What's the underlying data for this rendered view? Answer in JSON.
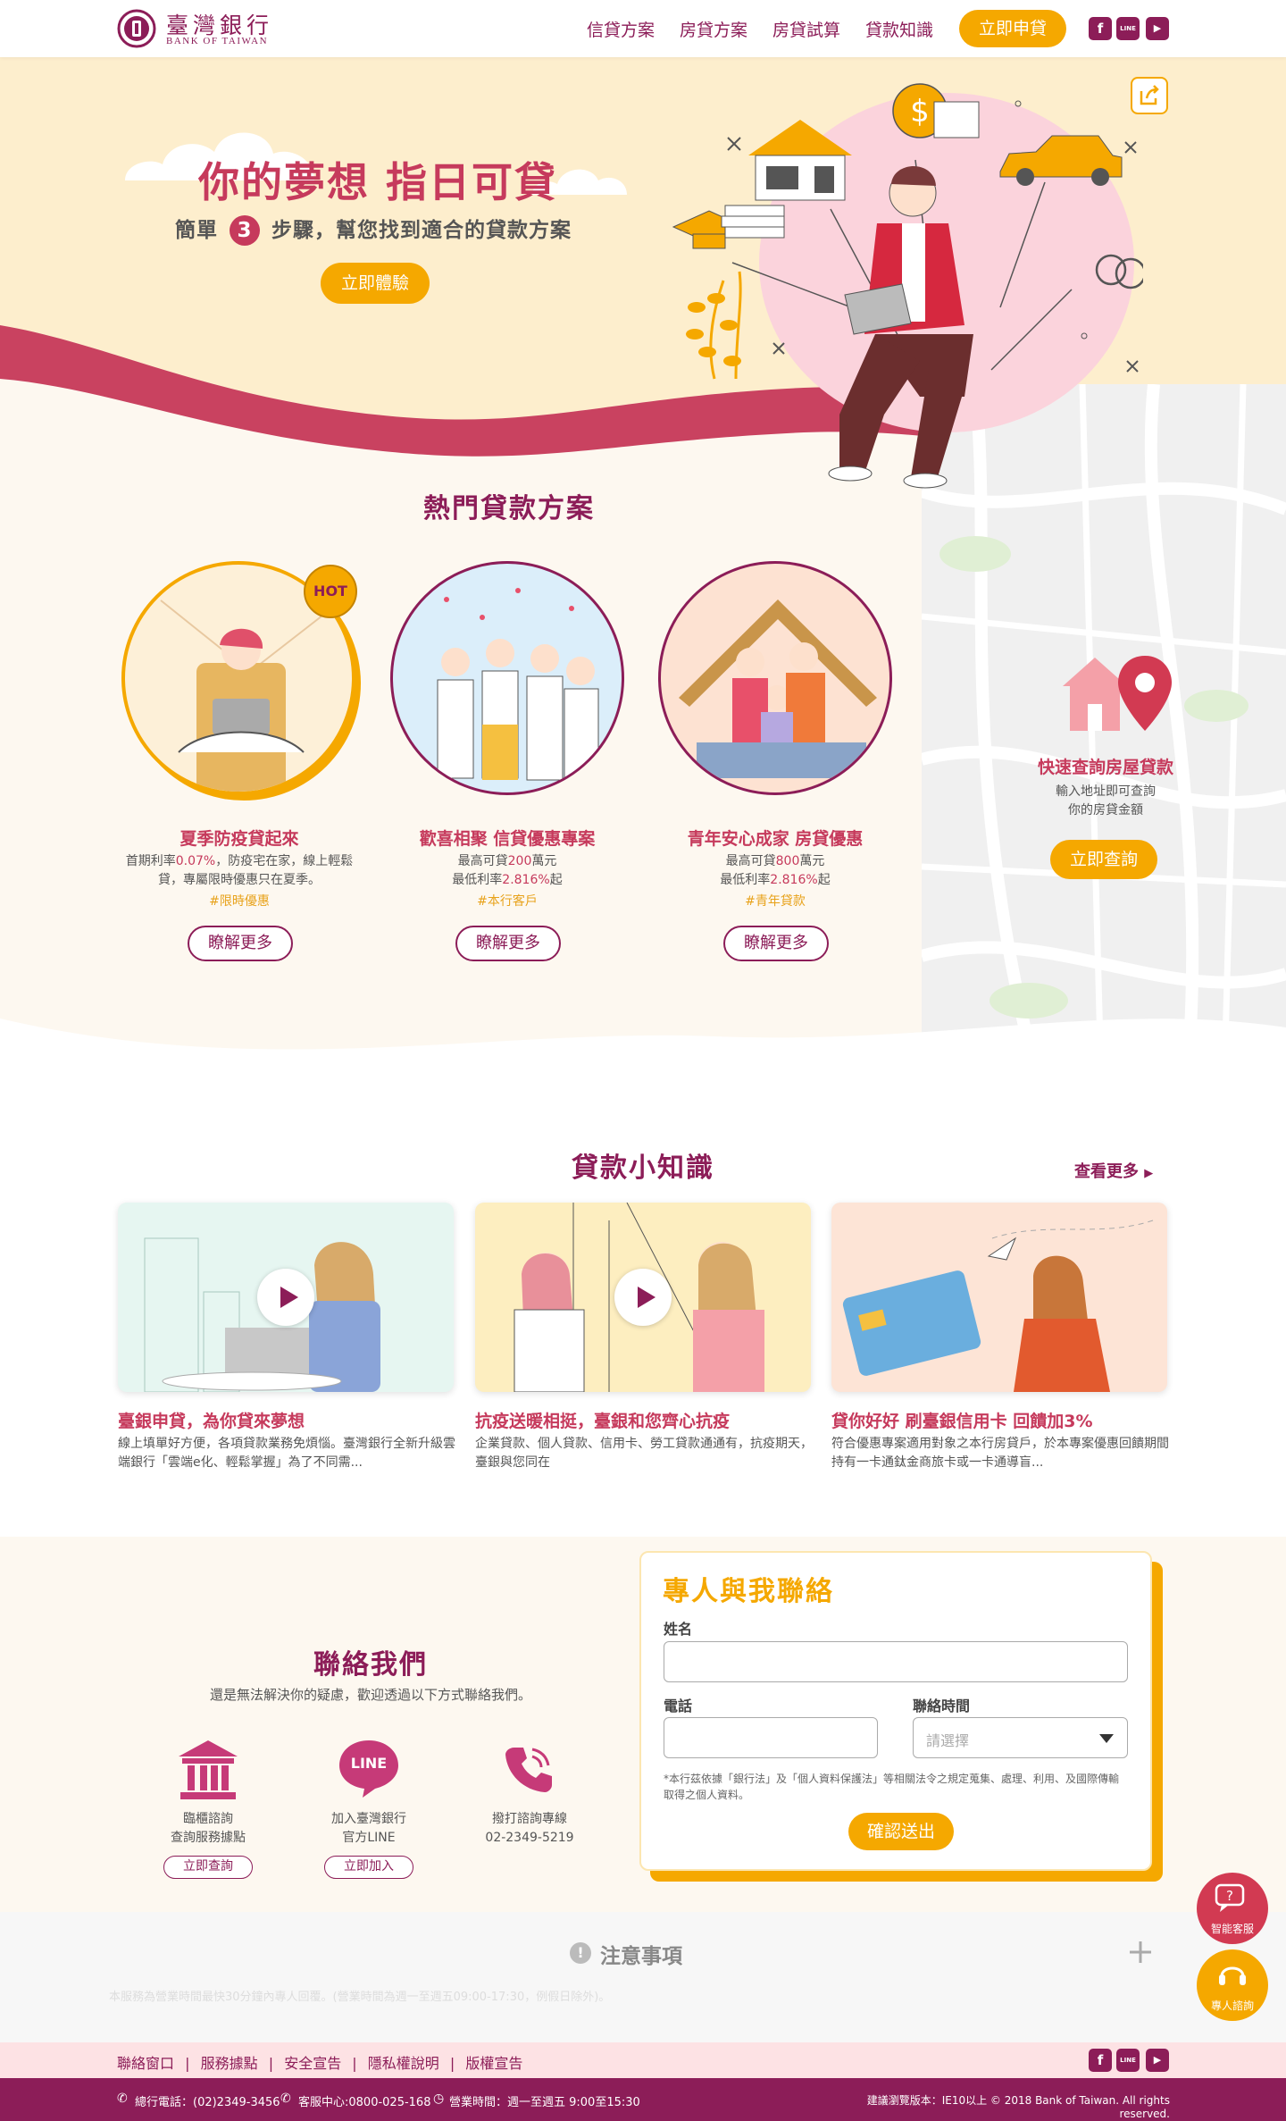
{
  "header": {
    "logo_cn": "臺灣銀行",
    "logo_en": "BANK OF TAIWAN",
    "nav": [
      "信貸方案",
      "房貸方案",
      "房貸試算",
      "貸款知識"
    ],
    "apply_label": "立即申貸",
    "social": [
      "f",
      "LINE",
      "▶"
    ]
  },
  "hero": {
    "title": "你的夢想 指日可貸",
    "sub_pre": "簡單",
    "sub_num": "3",
    "sub_post": "步驟，幫您找到適合的貸款方案",
    "cta": "立即體驗"
  },
  "popular": {
    "title": "熱門貸款方案",
    "cards": [
      {
        "badge": "HOT",
        "title": "夏季防疫貸起來",
        "line1_pre": "首期利率",
        "line1_hl": "0.07%",
        "line1_post": "，防疫宅在家，線上輕鬆",
        "line2": "貸，專屬限時優惠只在夏季。",
        "tag": "#限時優惠",
        "more": "瞭解更多"
      },
      {
        "title": "歡喜相聚 信貸優惠專案",
        "line1_pre": "最高可貸",
        "line1_hl": "200",
        "line1_post": "萬元",
        "line2_pre": "最低利率",
        "line2_hl": "2.816%",
        "line2_post": "起",
        "tag": "#本行客戶",
        "more": "瞭解更多"
      },
      {
        "title": "青年安心成家 房貸優惠",
        "line1_pre": "最高可貸",
        "line1_hl": "800",
        "line1_post": "萬元",
        "line2_pre": "最低利率",
        "line2_hl": "2.816%",
        "line2_post": "起",
        "tag": "#青年貸款",
        "more": "瞭解更多"
      }
    ]
  },
  "map": {
    "title": "快速查詢房屋貸款",
    "desc1": "輸入地址即可查詢",
    "desc2": "你的房貸金額",
    "cta": "立即查詢"
  },
  "knowledge": {
    "title": "貸款小知識",
    "more": "查看更多",
    "cards": [
      {
        "title": "臺銀申貸，為你貸來夢想",
        "desc": "線上填單好方便，各項貸款業務免煩惱。臺灣銀行全新升級雲端銀行「雲端e化、輕鬆掌握」為了不同需..."
      },
      {
        "title": "抗疫送暖相挺，臺銀和您齊心抗疫",
        "desc": "企業貸款、個人貸款、信用卡、勞工貸款通通有，抗疫期天，臺銀與您同在"
      },
      {
        "title": "貸你好好 刷臺銀信用卡 回饋加3%",
        "desc": "符合優惠專案適用對象之本行房貸戶，於本專案優惠回饋期間持有一卡通鈦金商旅卡或一卡通導盲..."
      }
    ]
  },
  "contact": {
    "title": "聯絡我們",
    "sub": "還是無法解決你的疑慮，歡迎透過以下方式聯絡我們。",
    "items": [
      {
        "line1": "臨櫃諮詢",
        "line2": "查詢服務據點",
        "btn": "立即查詢"
      },
      {
        "line1": "加入臺灣銀行",
        "line2": "官方LINE",
        "btn": "立即加入",
        "icon_text": "LINE"
      },
      {
        "line1": "撥打諮詢專線",
        "line2": "02-2349-5219"
      }
    ]
  },
  "form": {
    "title": "專人與我聯絡",
    "name_label": "姓名",
    "phone_label": "電話",
    "time_label": "聯絡時間",
    "time_placeholder": "請選擇",
    "note": "*本行茲依據「銀行法」及「個人資料保護法」等相關法令之規定蒐集、處理、利用、及國際傳輸取得之個人資料。",
    "submit": "確認送出"
  },
  "notice": {
    "title": "注意事項",
    "text": "本服務為營業時間最快30分鐘內專人回覆。(營業時間為週一至週五09:00-17:30，例假日除外)。"
  },
  "floating": {
    "ai": "智能客服",
    "agent": "專人諮詢"
  },
  "footer": {
    "links": [
      "聯絡窗口",
      "服務據點",
      "安全宣告",
      "隱私權說明",
      "版權宣告"
    ],
    "tel": "總行電話：(02)2349-3456",
    "service": "客服中心:0800-025-168",
    "hours": "營業時間：週一至週五 9:00至15:30",
    "copyright": "建議瀏覽版本：IE10以上 © 2018 Bank of Taiwan. All rights reserved."
  },
  "colors": {
    "primary": "#8c1d58",
    "accent": "#f5a800",
    "pink": "#c63a5c",
    "cream": "#fdeecd"
  }
}
